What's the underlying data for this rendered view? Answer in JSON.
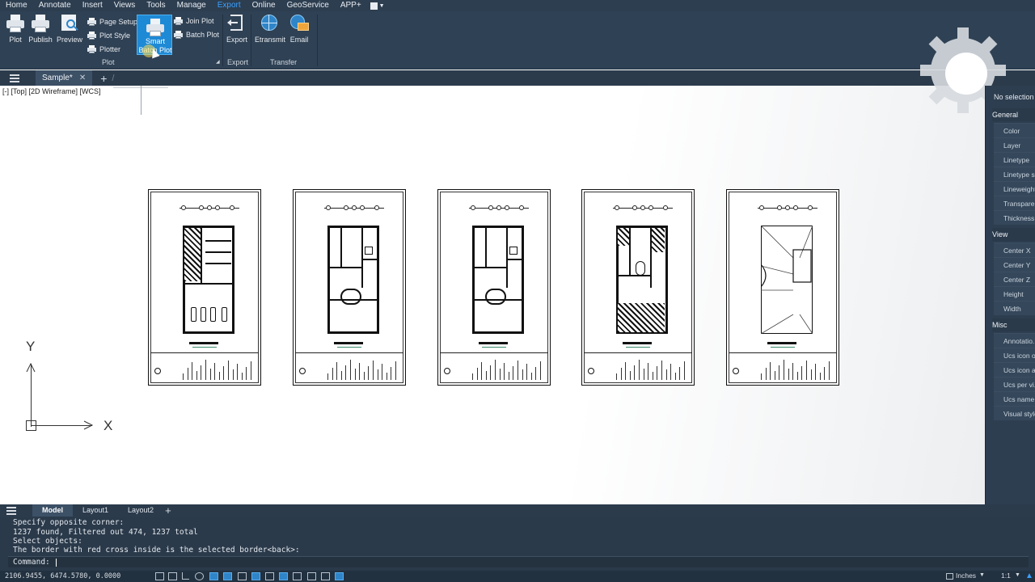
{
  "menu": [
    "Home",
    "Annotate",
    "Insert",
    "Views",
    "Tools",
    "Manage",
    "Export",
    "Online",
    "GeoService",
    "APP+"
  ],
  "menu_active": "Export",
  "ribbon": {
    "plot": "Plot",
    "publish": "Publish",
    "preview": "Preview",
    "page_setup": "Page Setup",
    "plot_style": "Plot Style",
    "plotter": "Plotter",
    "smart_batch_line1": "Smart",
    "smart_batch_line2": "Batch Plot",
    "join_plot": "Join Plot",
    "batch_plot": "Batch Plot",
    "group_plot": "Plot",
    "export": "Export",
    "group_export": "Export",
    "etransmit": "Etransmit",
    "email": "Email",
    "group_transfer": "Transfer"
  },
  "doc_tab": "Sample*",
  "viewport_label": "[-] [Top] [2D Wireframe] [WCS]",
  "ucs": {
    "x": "X",
    "y": "Y"
  },
  "properties": {
    "selection": "No selection",
    "sections": [
      {
        "title": "General",
        "rows": [
          "Color",
          "Layer",
          "Linetype",
          "Linetype s...",
          "Lineweight",
          "Transpare...",
          "Thickness"
        ]
      },
      {
        "title": "View",
        "rows": [
          "Center X",
          "Center Y",
          "Center Z",
          "Height",
          "Width"
        ]
      },
      {
        "title": "Misc",
        "rows": [
          "Annotatio...",
          "Ucs icon o...",
          "Ucs icon a...",
          "Ucs per vi...",
          "Ucs name",
          "Visual style"
        ]
      }
    ]
  },
  "layout_tabs": [
    "Model",
    "Layout1",
    "Layout2"
  ],
  "command_history": [
    "Specify opposite corner:",
    "1237 found, Filtered out 474, 1237 total",
    "Select objects:",
    "The border with red cross inside is the selected border<back>:"
  ],
  "command_prompt": "Command:",
  "status": {
    "coords": "2106.9455, 6474.5780, 0.0000",
    "units": "Inches",
    "scale": "1:1"
  },
  "colors": {
    "accent": "#1e8ad6",
    "chrome": "#2d3e50",
    "menu_active": "#3aa0ff"
  }
}
